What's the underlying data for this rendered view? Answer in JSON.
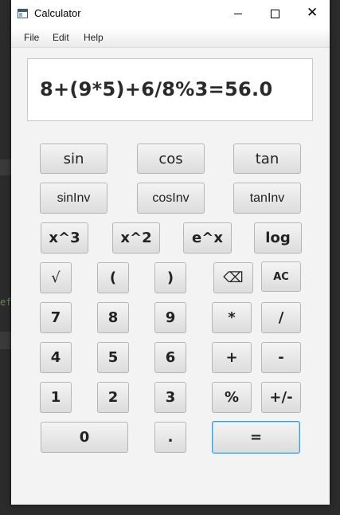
{
  "window": {
    "title": "Calculator",
    "controls": {
      "minimize": "",
      "close": "✕"
    }
  },
  "menubar": {
    "items": [
      "File",
      "Edit",
      "Help"
    ]
  },
  "display": {
    "expression": "8+(9*5)+6/8%3=56.0"
  },
  "buttons": {
    "sin": "sin",
    "cos": "cos",
    "tan": "tan",
    "sinInv": "sinInv",
    "cosInv": "cosInv",
    "tanInv": "tanInv",
    "cube": "x^3",
    "square": "x^2",
    "exp": "e^x",
    "log": "log",
    "sqrt": "√",
    "lparen": "(",
    "rparen": ")",
    "backspace": "⌫",
    "clear": "AC",
    "d7": "7",
    "d8": "8",
    "d9": "9",
    "mul": "*",
    "div": "/",
    "d4": "4",
    "d5": "5",
    "d6": "6",
    "add": "+",
    "sub": "-",
    "d1": "1",
    "d2": "2",
    "d3": "3",
    "mod": "%",
    "negate": "+/-",
    "d0": "0",
    "dot": ".",
    "equals": "="
  },
  "background": {
    "editor_fragment": "ef"
  },
  "colors": {
    "focus_border": "#2d9fd9",
    "button_top": "#f4f4f4",
    "button_bottom": "#dcdcdc"
  }
}
